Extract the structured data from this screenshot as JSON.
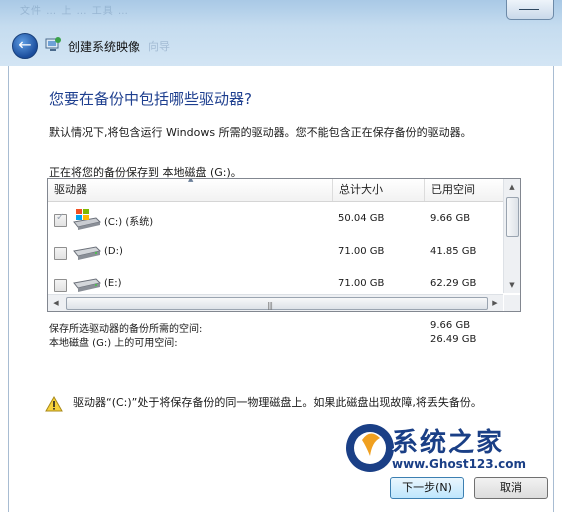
{
  "window": {
    "title": "创建系统映像",
    "title_ghost": "向导",
    "ghost_bar": "文件 … 上 … 工具 …"
  },
  "heading": "您要在备份中包括哪些驱动器?",
  "description": "默认情况下,将包含运行 Windows 所需的驱动器。您不能包含正在保存备份的驱动器。",
  "save_location": "正在将您的备份保存到 本地磁盘 (G:)。",
  "table": {
    "columns": [
      "驱动器",
      "总计大小",
      "已用空间"
    ],
    "rows": [
      {
        "drive": "(C:) (系统)",
        "total": "50.04 GB",
        "used": "9.66 GB",
        "checked": true,
        "disabled": true,
        "icon": "windows-drive-icon"
      },
      {
        "drive": "(D:)",
        "total": "71.00 GB",
        "used": "41.85 GB",
        "checked": false,
        "icon": "hard-drive-icon"
      },
      {
        "drive": "(E:)",
        "total": "71.00 GB",
        "used": "62.29 GB",
        "checked": false,
        "icon": "hard-drive-icon"
      }
    ]
  },
  "space": {
    "required_label": "保存所选驱动器的备份所需的空间:",
    "required_value": "9.66 GB",
    "available_label": "本地磁盘 (G:) 上的可用空间:",
    "available_value": "26.49 GB"
  },
  "warning": "驱动器“(C:)”处于将保存备份的同一物理磁盘上。如果此磁盘出现故障,将丢失备份。",
  "watermark": {
    "title": "系统之家",
    "url": "www.Ghost123.com"
  },
  "buttons": {
    "next": "下一步(N)",
    "cancel": "取消"
  },
  "colors": {
    "heading": "#1e3f8f",
    "accent": "#3c7fb1"
  }
}
